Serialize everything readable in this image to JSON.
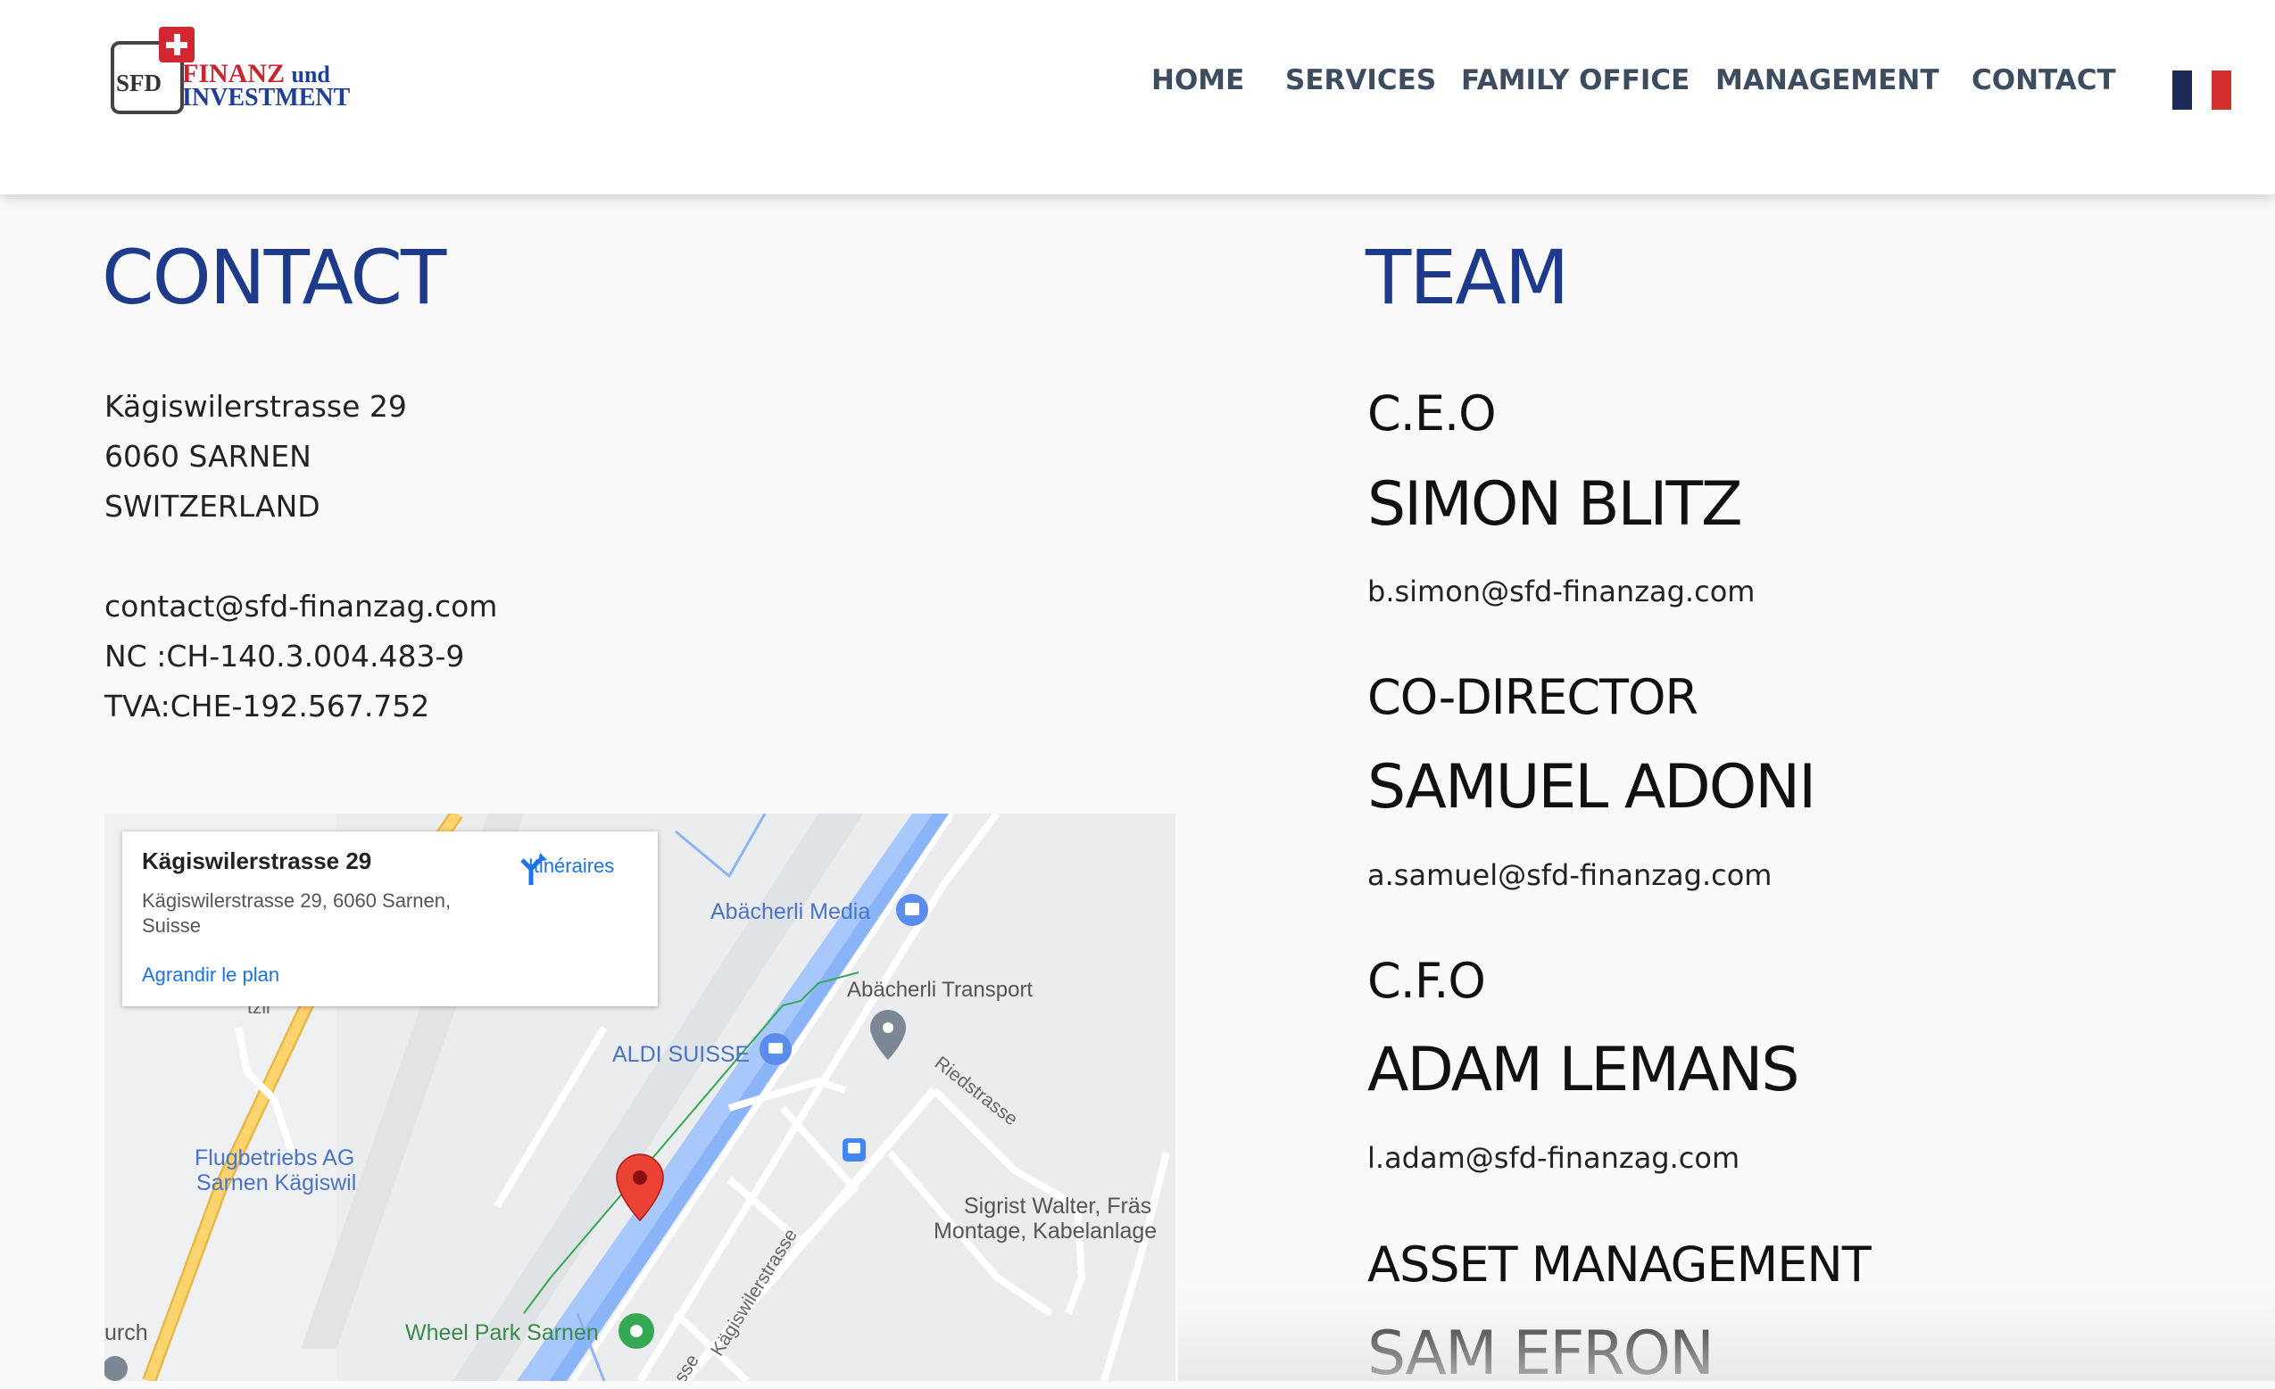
{
  "header": {
    "logo": {
      "sfd": "SFD",
      "line1": "FINANZ",
      "und": "und",
      "line2": "INVESTMENT"
    },
    "nav": [
      {
        "label": "HOME"
      },
      {
        "label": "SERVICES"
      },
      {
        "label": "FAMILY OFFICE"
      },
      {
        "label": "MANAGEMENT"
      },
      {
        "label": "CONTACT"
      }
    ],
    "flag_colors": [
      "#1c2b5a",
      "#ffffff",
      "#d32f2f"
    ]
  },
  "contact": {
    "heading": "CONTACT",
    "address": [
      "Kägiswilerstrasse 29",
      "6060 SARNEN",
      "SWITZERLAND"
    ],
    "email": "contact@sfd-finanzag.com",
    "nc": "NC :CH-140.3.004.483-9",
    "tva": "TVA:CHE-192.567.752"
  },
  "map": {
    "card_title": "Kägiswilerstrasse 29",
    "card_address": "Kägiswilerstrasse 29, 6060 Sarnen, Suisse",
    "directions_label": "Itinéraires",
    "enlarge_link": "Agrandir le plan",
    "labels": {
      "abacherli_media": "Abächerli Media",
      "abacherli_transport": "Abächerli Transport",
      "aldi": "ALDI SUISSE",
      "flugbetriebs_1": "Flugbetriebs AG",
      "flugbetriebs_2": "Sarnen Kägiswil",
      "riedstrasse": "Riedstrasse",
      "sigrist_1": "Sigrist Walter, Fräs",
      "sigrist_2": "Montage, Kabelanlage",
      "wheel_park": "Wheel Park Sarnen",
      "kagiswilerstrasse": "Kägiswilerstrasse",
      "urch": "urch",
      "tzli": "tzli",
      "sse": "sse"
    }
  },
  "team": {
    "heading": "TEAM",
    "members": [
      {
        "role": "C.E.O",
        "name": "SIMON BLITZ",
        "email": "b.simon@sfd-finanzag.com"
      },
      {
        "role": "CO-DIRECTOR",
        "name": "SAMUEL ADONI",
        "email": "a.samuel@sfd-finanzag.com"
      },
      {
        "role": "C.F.O",
        "name": "ADAM LEMANS",
        "email": "l.adam@sfd-finanzag.com"
      },
      {
        "role": "ASSET MANAGEMENT",
        "name": "SAM EFRON"
      }
    ]
  },
  "colors": {
    "heading_blue": "#1e3a8a",
    "nav_text": "#3d4c5e",
    "link_blue": "#1a73e8",
    "map_pin": "#d93025"
  }
}
